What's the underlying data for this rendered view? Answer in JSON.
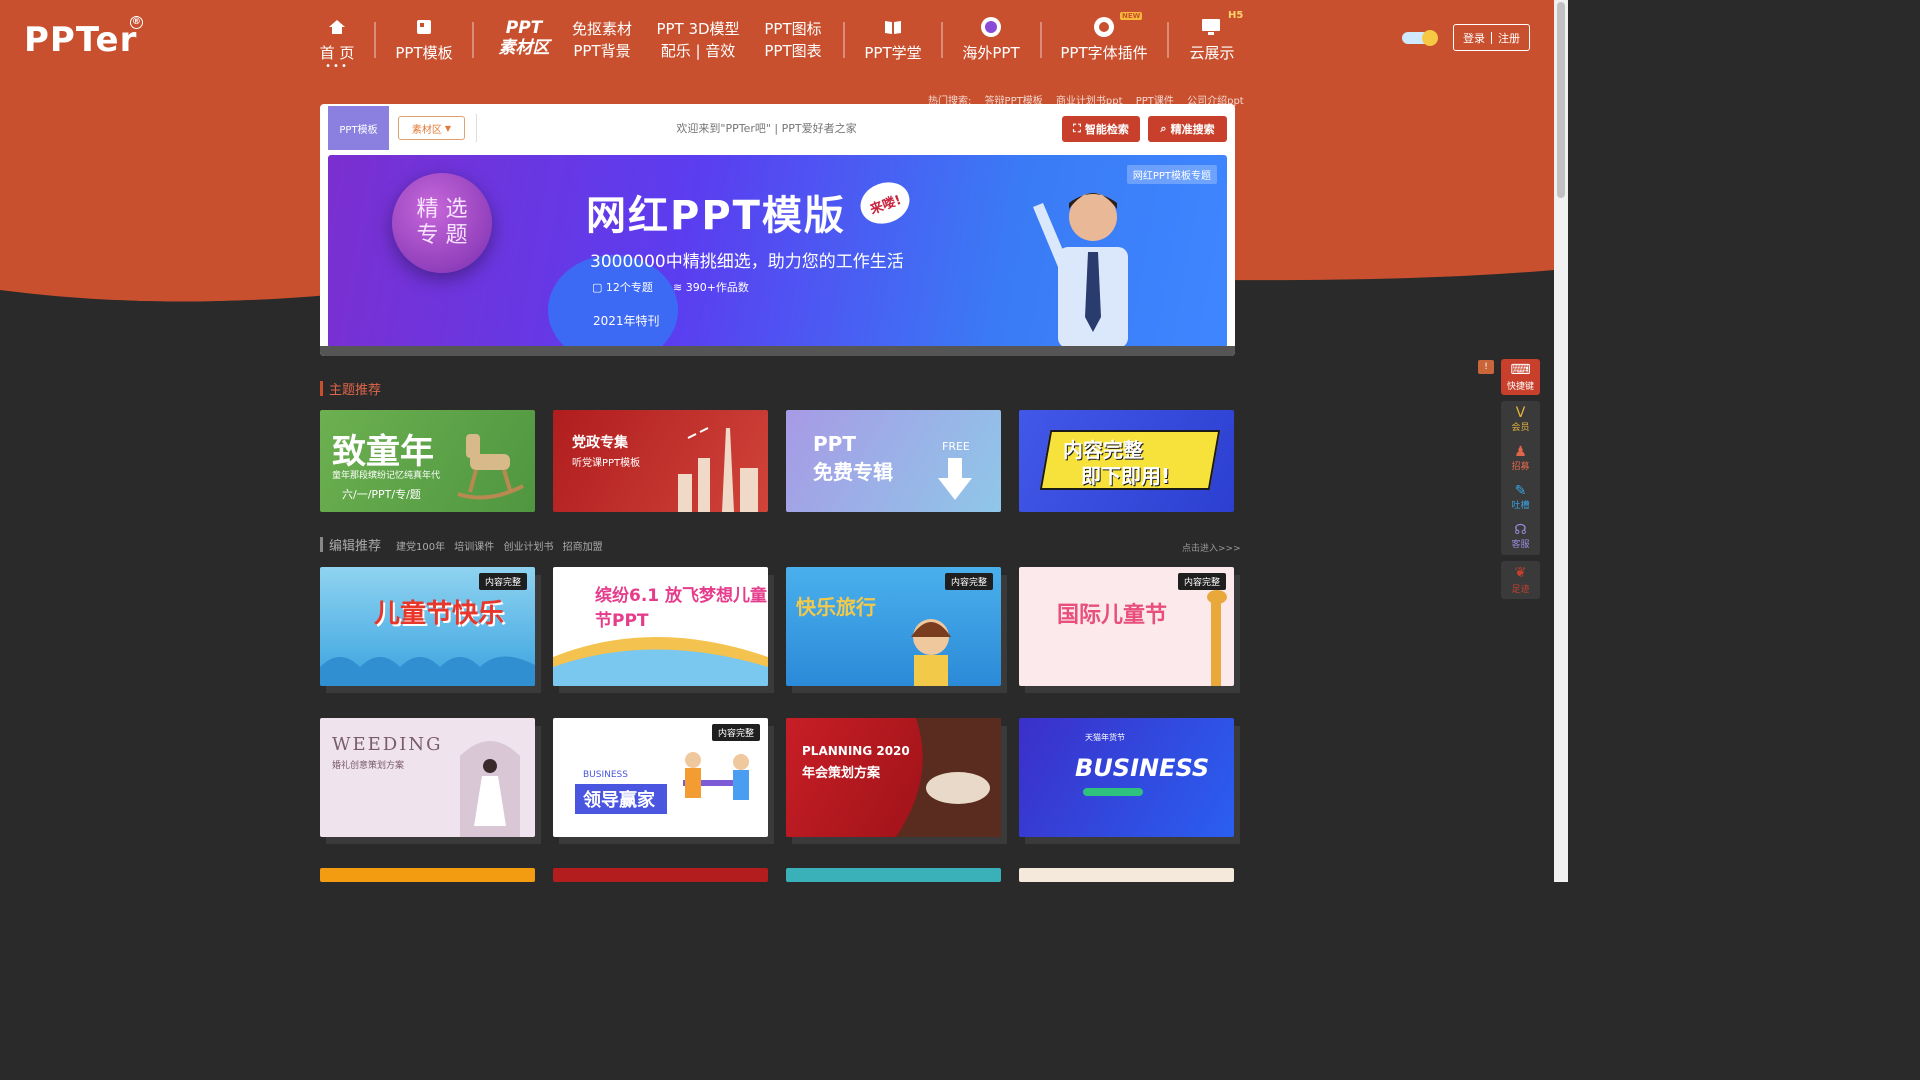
{
  "brand": {
    "logo": "PPTer",
    "reg": "®"
  },
  "nav": {
    "home": "首 页",
    "ppt_template": "PPT模板",
    "material_line1": "PPT",
    "material_line2": "素材区",
    "cutout": "免抠素材",
    "ppt_bg": "PPT背景",
    "model3d": "PPT 3D模型",
    "music": "配乐 | 音效",
    "icons": "PPT图标",
    "charts": "PPT图表",
    "school": "PPT学堂",
    "overseas": "海外PPT",
    "font_plugin": "PPT字体插件",
    "cloud": "云展示",
    "badge_new": "NEW",
    "badge_h5": "H5"
  },
  "auth": {
    "login": "登录",
    "register": "注册"
  },
  "hot_search": {
    "label": "热门搜索:",
    "items": [
      "答辩PPT模板",
      "商业计划书ppt",
      "PPT课件",
      "公司介绍ppt"
    ]
  },
  "search": {
    "tab": "PPT模板",
    "select": "素材区",
    "placeholder": "欢迎来到\"PPTer吧\" | PPT爱好者之家",
    "smart_btn": "智能检索",
    "precise_btn": "精准搜索"
  },
  "banner": {
    "circle_line1": "精 选",
    "circle_line2": "专 题",
    "title": "网红PPT模版",
    "stamp": "来喽!",
    "subtitle": "3000000中精挑细选，助力您的工作生活",
    "stat1": "12个专题",
    "stat2": "390+作品数",
    "year": "2021年特刊",
    "tag": "网红PPT模板专题"
  },
  "themes": {
    "title": "主题推荐",
    "cards": [
      {
        "line1": "致童年",
        "line2": "童年那段缤纷记忆纯真年代",
        "line3": "六/一/PPT/专/题",
        "color": "#5fa14a"
      },
      {
        "line1": "党政专集",
        "line2": "听党课PPT模板",
        "line3": "",
        "color": "#b0211f"
      },
      {
        "line1": "PPT",
        "line2": "免费专辑",
        "line3": "FREE",
        "color": "#9b8fe0"
      },
      {
        "line1": "内容完整",
        "line2": "即下即用!",
        "line3": "",
        "color": "#3b55e0"
      }
    ]
  },
  "editor": {
    "title": "编辑推荐",
    "tags": [
      "建党100年",
      "培训课件",
      "创业计划书",
      "招商加盟"
    ],
    "more": "点击进入>>>",
    "ribbon": "内容完整",
    "row1": [
      {
        "title": "儿童节快乐",
        "ribbon": true
      },
      {
        "title": "缤纷6.1 放飞梦想儿童节PPT",
        "ribbon": false
      },
      {
        "title": "快乐旅行",
        "ribbon": true
      },
      {
        "title": "国际儿童节",
        "ribbon": true
      }
    ],
    "row2": [
      {
        "title": "WEEDING",
        "sub": "婚礼创意策划方案",
        "ribbon": false
      },
      {
        "title": "领导赢家",
        "sub": "BUSINESS",
        "ribbon": true
      },
      {
        "title": "PLANNING 2020",
        "sub": "年会策划方案",
        "ribbon": false
      },
      {
        "title": "BUSINESS",
        "sub": "天猫年货节",
        "ribbon": false
      }
    ]
  },
  "float_bar": {
    "shortcut": "快捷键",
    "vip": "会员",
    "recruit": "招募",
    "feedback": "吐槽",
    "service": "客服",
    "footprint": "足迹"
  },
  "colors": {
    "hero": "#c9502f",
    "dark_bg": "#2a2a2a",
    "accent_red": "#c8402c",
    "tab_purple": "#8b7fe0"
  }
}
